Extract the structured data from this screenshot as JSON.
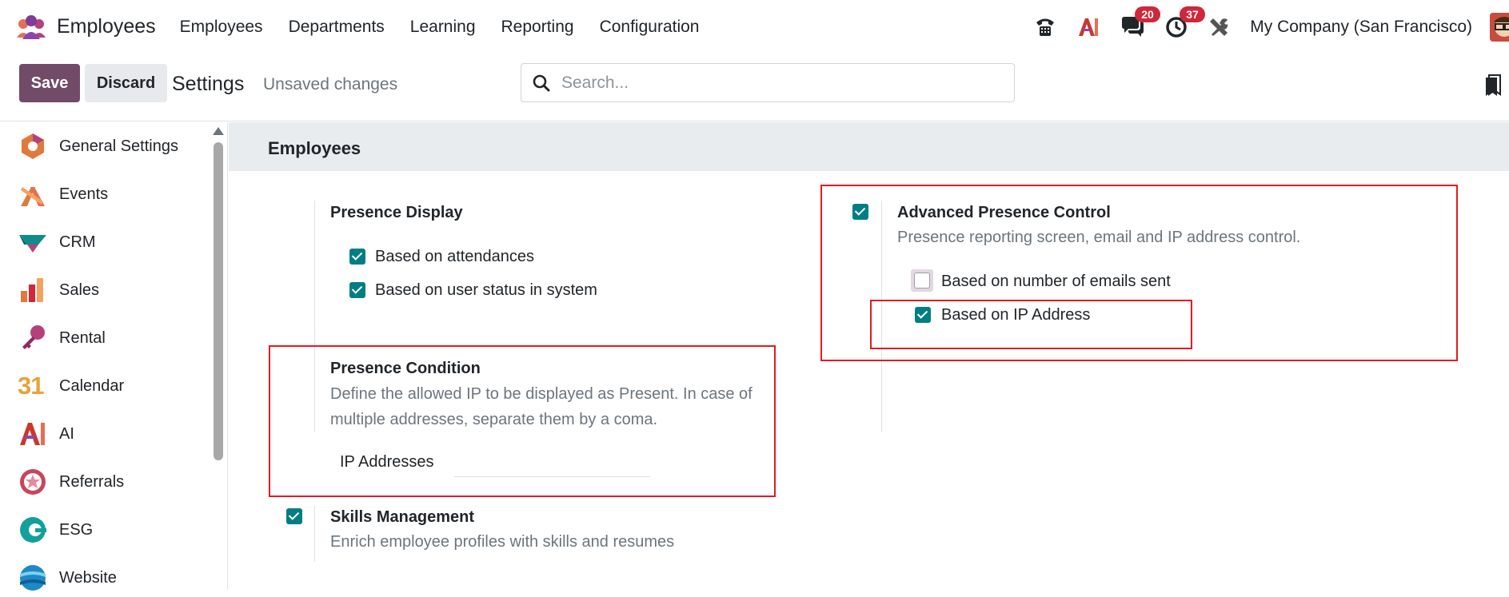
{
  "navbar": {
    "app_title": "Employees",
    "menu": [
      "Employees",
      "Departments",
      "Learning",
      "Reporting",
      "Configuration"
    ],
    "messages_count": "20",
    "activities_count": "37",
    "company": "My Company (San Francisco)"
  },
  "control_panel": {
    "save_label": "Save",
    "discard_label": "Discard",
    "title": "Settings",
    "unsaved": "Unsaved changes",
    "search_placeholder": "Search..."
  },
  "sidebar": {
    "items": [
      {
        "label": "General Settings",
        "icon": "general-settings-icon"
      },
      {
        "label": "Events",
        "icon": "events-icon"
      },
      {
        "label": "CRM",
        "icon": "crm-icon"
      },
      {
        "label": "Sales",
        "icon": "sales-icon"
      },
      {
        "label": "Rental",
        "icon": "rental-icon"
      },
      {
        "label": "Calendar",
        "icon": "calendar-icon"
      },
      {
        "label": "AI",
        "icon": "ai-icon"
      },
      {
        "label": "Referrals",
        "icon": "referrals-icon"
      },
      {
        "label": "ESG",
        "icon": "esg-icon"
      },
      {
        "label": "Website",
        "icon": "website-icon"
      }
    ],
    "calendar_icon_text": "31"
  },
  "main": {
    "section_title": "Employees",
    "presence_display": {
      "title": "Presence Display",
      "options": [
        {
          "label": "Based on attendances",
          "checked": true
        },
        {
          "label": "Based on user status in system",
          "checked": true
        }
      ]
    },
    "advanced_presence": {
      "title": "Advanced Presence Control",
      "description": "Presence reporting screen, email and IP address control.",
      "checked": true,
      "options": [
        {
          "label": "Based on number of emails sent",
          "checked": false
        },
        {
          "label": "Based on IP Address",
          "checked": true
        }
      ]
    },
    "presence_condition": {
      "title": "Presence Condition",
      "description": "Define the allowed IP to be displayed as Present. In case of multiple addresses, separate them by a coma.",
      "field_label": "IP Addresses",
      "field_value": ""
    },
    "skills": {
      "title": "Skills Management",
      "description": "Enrich employee profiles with skills and resumes",
      "checked": true
    }
  },
  "colors": {
    "brand": "#714b67",
    "checkbox": "#017e84",
    "highlight": "#e01b24",
    "badge": "#d1263b"
  }
}
